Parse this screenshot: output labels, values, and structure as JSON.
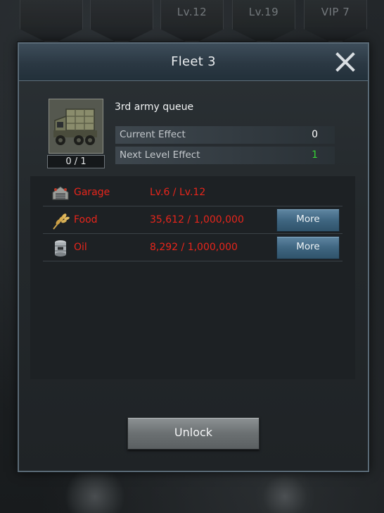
{
  "background": {
    "top_slots": [
      "",
      "",
      "Lv.12",
      "Lv.19",
      "VIP 7"
    ]
  },
  "dialog": {
    "title": "Fleet 3",
    "close_icon": "close-icon"
  },
  "queue": {
    "name": "3rd army queue",
    "count": "0 / 1",
    "thumbnail_icon": "truck-icon",
    "current_effect_label": "Current Effect",
    "current_effect_value": "0",
    "next_effect_label": "Next Level Effect",
    "next_effect_value": "1",
    "next_effect_color": "#35d635"
  },
  "requirements": [
    {
      "icon": "garage-icon",
      "name": "Garage",
      "amount": "Lv.6 / Lv.12",
      "button": ""
    },
    {
      "icon": "wheat-icon",
      "name": "Food",
      "amount": "35,612 / 1,000,000",
      "button": "More"
    },
    {
      "icon": "oil-barrel-icon",
      "name": "Oil",
      "amount": "8,292 / 1,000,000",
      "button": "More"
    }
  ],
  "requirement_color": "#e8251b",
  "unlock_button": {
    "label": "Unlock"
  }
}
